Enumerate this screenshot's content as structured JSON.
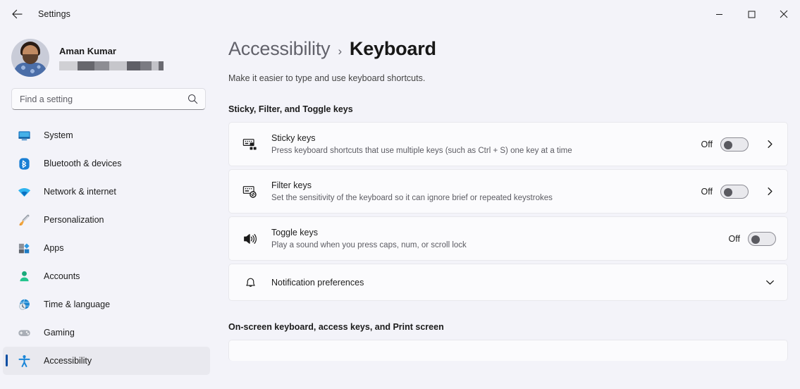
{
  "window": {
    "title": "Settings",
    "back_icon": "back-arrow-icon",
    "minimize_label": "Minimize",
    "maximize_label": "Maximize",
    "close_label": "Close"
  },
  "profile": {
    "name": "Aman Kumar",
    "email_redacted": true
  },
  "search": {
    "placeholder": "Find a setting",
    "value": "",
    "icon": "search-icon"
  },
  "sidebar": {
    "items": [
      {
        "label": "System",
        "icon": "monitor-icon",
        "selected": false
      },
      {
        "label": "Bluetooth & devices",
        "icon": "bluetooth-icon",
        "selected": false
      },
      {
        "label": "Network & internet",
        "icon": "wifi-icon",
        "selected": false
      },
      {
        "label": "Personalization",
        "icon": "paintbrush-icon",
        "selected": false
      },
      {
        "label": "Apps",
        "icon": "apps-icon",
        "selected": false
      },
      {
        "label": "Accounts",
        "icon": "person-icon",
        "selected": false
      },
      {
        "label": "Time & language",
        "icon": "globe-clock-icon",
        "selected": false
      },
      {
        "label": "Gaming",
        "icon": "gamepad-icon",
        "selected": false
      },
      {
        "label": "Accessibility",
        "icon": "accessibility-person-icon",
        "selected": true
      }
    ]
  },
  "page": {
    "breadcrumb_parent": "Accessibility",
    "breadcrumb_separator": "›",
    "breadcrumb_current": "Keyboard",
    "subtitle": "Make it easier to type and use keyboard shortcuts.",
    "sections": [
      {
        "title": "Sticky, Filter, and Toggle keys",
        "cards": [
          {
            "title": "Sticky keys",
            "desc": "Press keyboard shortcuts that use multiple keys (such as Ctrl + S) one key at a time",
            "icon": "sticky-keys-icon",
            "toggle_state": "Off",
            "toggle_on": false,
            "chevron": "chevron-right-icon"
          },
          {
            "title": "Filter keys",
            "desc": "Set the sensitivity of the keyboard so it can ignore brief or repeated keystrokes",
            "icon": "filter-keys-icon",
            "toggle_state": "Off",
            "toggle_on": false,
            "chevron": "chevron-right-icon"
          },
          {
            "title": "Toggle keys",
            "desc": "Play a sound when you press caps, num, or scroll lock",
            "icon": "speaker-icon",
            "toggle_state": "Off",
            "toggle_on": false,
            "chevron": null
          },
          {
            "title": "Notification preferences",
            "desc": null,
            "icon": "bell-icon",
            "toggle_state": null,
            "toggle_on": null,
            "chevron": "chevron-down-icon"
          }
        ]
      },
      {
        "title": "On-screen keyboard, access keys, and Print screen",
        "cards": []
      }
    ]
  },
  "colors": {
    "window_bg": "#f3f3f9",
    "card_bg": "#fbfbfd",
    "accent": "#0067c0",
    "selected_indicator": "#0d4fa3",
    "selected_nav_bg": "#e9e9ef"
  }
}
